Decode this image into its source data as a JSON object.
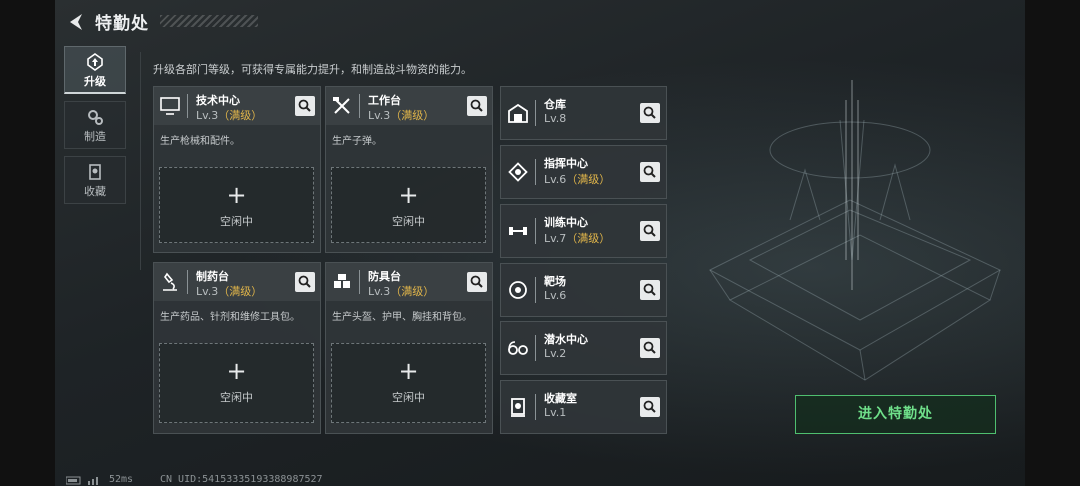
{
  "header": {
    "title": "特勤处"
  },
  "nav": [
    {
      "label": "升级",
      "icon": "upgrade-icon",
      "active": true
    },
    {
      "label": "制造",
      "icon": "gears-icon",
      "active": false
    },
    {
      "label": "收藏",
      "icon": "collection-icon",
      "active": false
    }
  ],
  "description": "升级各部门等级，可获得专属能力提升，和制造战斗物资的能力。",
  "cards": [
    {
      "name": "技术中心",
      "level": "Lv.3",
      "max": "（满级）",
      "desc": "生产枪械和配件。",
      "slot_plus": "+",
      "slot_label": "空闲中",
      "icon": "monitor-icon"
    },
    {
      "name": "工作台",
      "level": "Lv.3",
      "max": "（满级）",
      "desc": "生产子弹。",
      "slot_plus": "+",
      "slot_label": "空闲中",
      "icon": "tools-icon"
    },
    {
      "name": "制药台",
      "level": "Lv.3",
      "max": "（满级）",
      "desc": "生产药品、针剂和维修工具包。",
      "slot_plus": "+",
      "slot_label": "空闲中",
      "icon": "microscope-icon"
    },
    {
      "name": "防具台",
      "level": "Lv.3",
      "max": "（满级）",
      "desc": "生产头盔、护甲、胸挂和背包。",
      "slot_plus": "+",
      "slot_label": "空闲中",
      "icon": "armor-icon"
    }
  ],
  "facilities": [
    {
      "name": "仓库",
      "level": "Lv.8",
      "max": "",
      "icon": "warehouse-icon"
    },
    {
      "name": "指挥中心",
      "level": "Lv.6",
      "max": "（满级）",
      "icon": "chip-icon"
    },
    {
      "name": "训练中心",
      "level": "Lv.7",
      "max": "（满级）",
      "icon": "dumbbell-icon"
    },
    {
      "name": "靶场",
      "level": "Lv.6",
      "max": "",
      "icon": "target-icon"
    },
    {
      "name": "潜水中心",
      "level": "Lv.2",
      "max": "",
      "icon": "goggles-icon"
    },
    {
      "name": "收藏室",
      "level": "Lv.1",
      "max": "",
      "icon": "trophy-icon"
    }
  ],
  "enter_button": "进入特勤处",
  "footer": {
    "ping": "52ms",
    "uid": "CN UID:54153335193388987527"
  },
  "colors": {
    "max_level": "#e0b54a",
    "enter_accent": "#4fbf6f"
  }
}
